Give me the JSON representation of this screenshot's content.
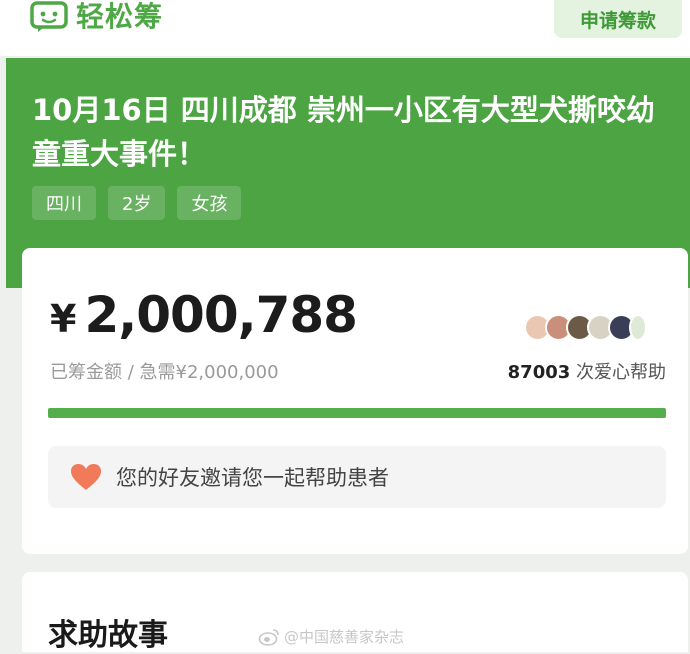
{
  "app": {
    "logo_text": "轻松筹",
    "apply_button": "申请筹款"
  },
  "campaign": {
    "title": "10月16日 四川成都 崇州一小区有大型犬撕咬幼童重大事件！",
    "tags": [
      "四川",
      "2岁",
      "女孩"
    ]
  },
  "funding": {
    "currency": "¥",
    "raised": "2,000,788",
    "target_label": "已筹金额 / 急需¥2,000,000",
    "helper_count": "87003",
    "helper_suffix": " 次爱心帮助",
    "progress_fraction": 1.0
  },
  "invite": {
    "text": "您的好友邀请您一起帮助患者"
  },
  "story": {
    "title": "求助故事"
  },
  "watermark": {
    "text": "@中国慈善家杂志"
  },
  "colors": {
    "brand_green": "#4ca443",
    "progress_green": "#56ad4c",
    "heart": "#f07a5a"
  },
  "icons": [
    "logo-icon",
    "heart-icon",
    "weibo-icon"
  ]
}
